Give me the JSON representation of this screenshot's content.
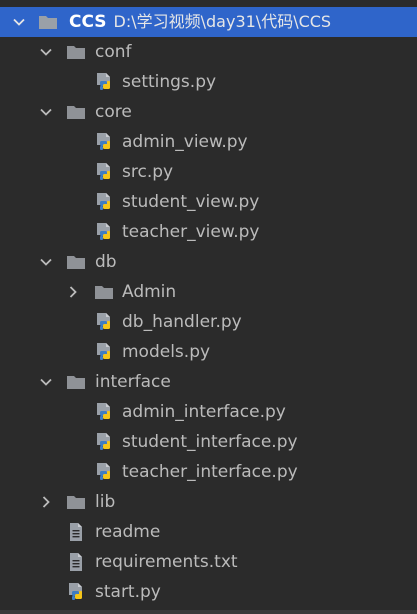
{
  "project": {
    "name": "CCS",
    "path": "D:\\学习视频\\day31\\代码\\CCS"
  },
  "colors": {
    "background": "#2b2b2b",
    "selected_row": "#2f65ca",
    "folder_icon": "#8f9297",
    "text": "#bbbbbb",
    "python_blue": "#3f7cc1",
    "python_yellow": "#f5c518"
  },
  "tree": [
    {
      "label": "conf",
      "type": "folder",
      "expanded": true,
      "depth": 1
    },
    {
      "label": "settings.py",
      "type": "python",
      "depth": 2
    },
    {
      "label": "core",
      "type": "folder",
      "expanded": true,
      "depth": 1
    },
    {
      "label": "admin_view.py",
      "type": "python",
      "depth": 2
    },
    {
      "label": "src.py",
      "type": "python",
      "depth": 2
    },
    {
      "label": "student_view.py",
      "type": "python",
      "depth": 2
    },
    {
      "label": "teacher_view.py",
      "type": "python",
      "depth": 2
    },
    {
      "label": "db",
      "type": "folder",
      "expanded": true,
      "depth": 1
    },
    {
      "label": "Admin",
      "type": "folder",
      "expanded": false,
      "depth": 2
    },
    {
      "label": "db_handler.py",
      "type": "python",
      "depth": 2
    },
    {
      "label": "models.py",
      "type": "python",
      "depth": 2
    },
    {
      "label": "interface",
      "type": "folder",
      "expanded": true,
      "depth": 1
    },
    {
      "label": "admin_interface.py",
      "type": "python",
      "depth": 2
    },
    {
      "label": "student_interface.py",
      "type": "python",
      "depth": 2
    },
    {
      "label": "teacher_interface.py",
      "type": "python",
      "depth": 2
    },
    {
      "label": "lib",
      "type": "folder",
      "expanded": false,
      "depth": 1
    },
    {
      "label": "readme",
      "type": "text",
      "depth": 1
    },
    {
      "label": "requirements.txt",
      "type": "text",
      "depth": 1
    },
    {
      "label": "start.py",
      "type": "python",
      "depth": 1
    }
  ]
}
